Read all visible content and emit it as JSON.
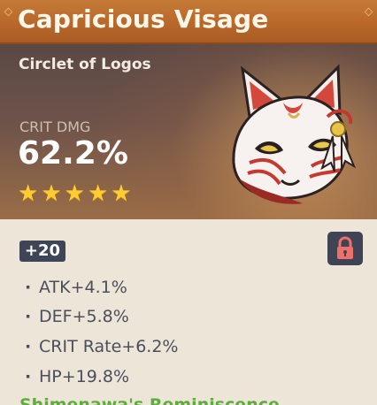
{
  "artifact": {
    "name": "Capricious Visage",
    "piece_type": "Circlet of Logos",
    "main_stat": {
      "label": "CRIT DMG",
      "value": "62.2%"
    },
    "rarity_stars": 5,
    "level": "+20",
    "locked": true,
    "substats": [
      {
        "text": "ATK+4.1%"
      },
      {
        "text": "DEF+5.8%"
      },
      {
        "text": "CRIT Rate+6.2%"
      },
      {
        "text": "HP+19.8%"
      }
    ],
    "set_name": "Shimenawa's Reminiscence"
  },
  "icons": {
    "star": "star-icon",
    "lock": "lock-icon",
    "artifact": "fox-mask-icon"
  },
  "colors": {
    "title_bar": "#b9682a",
    "star": "#ffcc32",
    "level_badge": "#3d4556",
    "lock_icon": "#ef6f6a",
    "set_bonus": "#5dac3c",
    "substat_text": "#4b4f5b"
  }
}
